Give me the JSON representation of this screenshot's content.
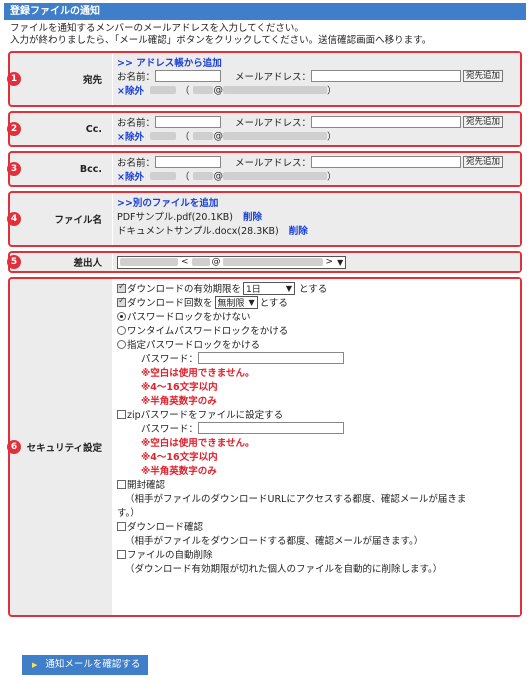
{
  "header": {
    "title": "登録ファイルの通知"
  },
  "intro": {
    "line1": "ファイルを通知するメンバーのメールアドレスを入力してください。",
    "line2": "入力が終わりましたら、「メール確認」ボタンをクリックしてください。送信確認画面へ移ります。"
  },
  "recipients": {
    "to": {
      "label": "宛先",
      "badge": "1",
      "address_book_link": ">> アドレス帳から追加"
    },
    "cc": {
      "label": "Cc.",
      "badge": "2"
    },
    "bcc": {
      "label": "Bcc.",
      "badge": "3"
    },
    "name_label": "お名前：",
    "email_label": "メールアドレス：",
    "add_button": "宛先追加",
    "exclude_link": "×除外",
    "paren_open": "（",
    "paren_close": "）",
    "at": "@"
  },
  "files": {
    "label": "ファイル名",
    "badge": "4",
    "add_link": ">>別のファイルを追加",
    "items": [
      {
        "name": "PDFサンプル.pdf(20.1KB)",
        "delete": "削除"
      },
      {
        "name": "ドキュメントサンプル.docx(28.3KB)",
        "delete": "削除"
      }
    ]
  },
  "sender": {
    "label": "差出人",
    "badge": "5",
    "lt": "<",
    "at": "@",
    "gt": ">"
  },
  "security": {
    "label": "セキュリティ設定",
    "badge": "6",
    "expiry_prefix": "ダウンロードの有効期限を",
    "expiry_value": "1日",
    "expiry_suffix": "とする",
    "count_prefix": "ダウンロード回数を",
    "count_value": "無制限",
    "count_suffix": "とする",
    "opt_none": "パスワードロックをかけない",
    "opt_onetime": "ワンタイムパスワードロックをかける",
    "opt_fixed": "指定パスワードロックをかける",
    "password_label": "パスワード：",
    "rule_blank": "※空白は使用できません。",
    "rule_length": "※4～16文字以内",
    "rule_alnum": "※半角英数字のみ",
    "zip_option": "zipパスワードをファイルに設定する",
    "open_confirm": "開封確認",
    "open_confirm_desc1": "（相手がファイルのダウンロードURLにアクセスする都度、確認メールが届きま",
    "open_confirm_desc2": "す。）",
    "dl_confirm": "ダウンロード確認",
    "dl_confirm_desc": "（相手がファイルをダウンロードする都度、確認メールが届きます。）",
    "auto_delete": "ファイルの自動削除",
    "auto_delete_desc": "（ダウンロード有効期限が切れた個人のファイルを自動的に削除します。）"
  },
  "footer": {
    "confirm_button": "通知メールを確認する"
  },
  "colors": {
    "accent": "#3f7fc9",
    "highlight": "#e0303c",
    "link": "#1a3fd6"
  }
}
